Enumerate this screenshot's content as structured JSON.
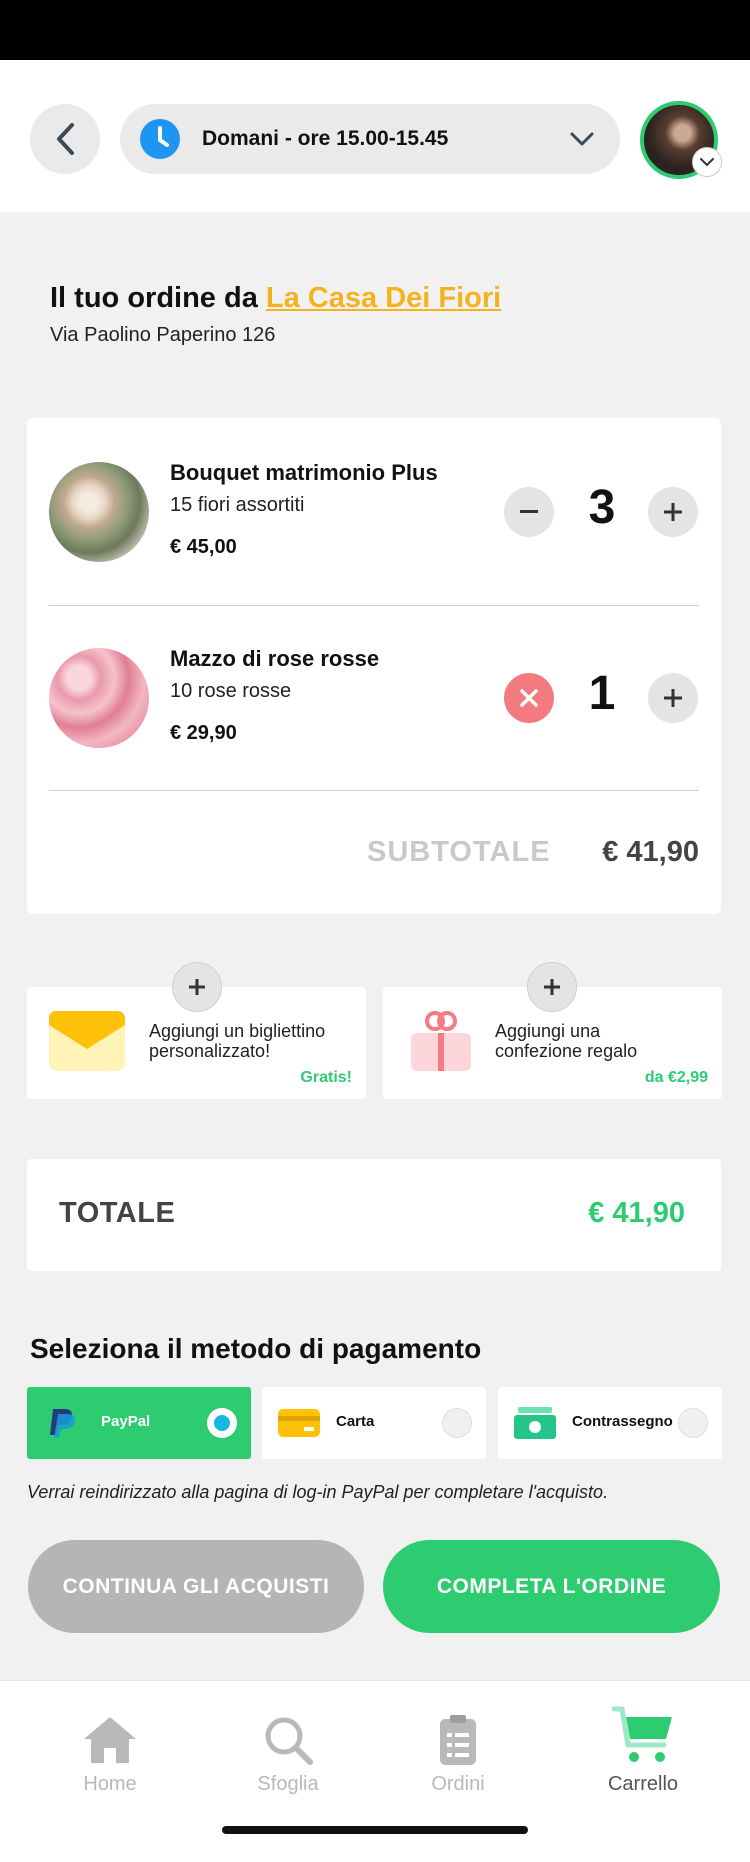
{
  "header": {
    "delivery_slot": "Domani - ore 15.00-15.45"
  },
  "order": {
    "title_prefix": "Il tuo ordine da",
    "shop_name": "La Casa Dei Fiori",
    "address": "Via Paolino Paperino 126"
  },
  "cart": {
    "items": [
      {
        "name": "Bouquet matrimonio Plus",
        "description": "15 fiori assortiti",
        "price": "€ 45,00",
        "quantity": "3"
      },
      {
        "name": "Mazzo di rose rosse",
        "description": "10 rose rosse",
        "price": "€ 29,90",
        "quantity": "1"
      }
    ],
    "subtotal_label": "SUBTOTALE",
    "subtotal_value": "€ 41,90"
  },
  "addons": [
    {
      "line1": "Aggiungi un bigliettino",
      "line2": "personalizzato!",
      "price": "Gratis!"
    },
    {
      "line1": "Aggiungi una",
      "line2": "confezione regalo",
      "price": "da €2,99"
    }
  ],
  "total": {
    "label": "TOTALE",
    "value": "€ 41,90"
  },
  "payment": {
    "title": "Seleziona il metodo di pagamento",
    "options": [
      {
        "label": "PayPal",
        "selected": true
      },
      {
        "label": "Carta",
        "selected": false
      },
      {
        "label": "Contrassegno",
        "selected": false
      }
    ],
    "note": "Verrai reindirizzato alla pagina di log-in PayPal per completare l'acquisto."
  },
  "actions": {
    "continue_label": "CONTINUA GLI ACQUISTI",
    "complete_label": "COMPLETA L'ORDINE"
  },
  "tabbar": {
    "items": [
      {
        "label": "Home",
        "icon": "home-icon"
      },
      {
        "label": "Sfoglia",
        "icon": "search-icon"
      },
      {
        "label": "Ordini",
        "icon": "clipboard-icon"
      },
      {
        "label": "Carrello",
        "icon": "cart-icon",
        "active": true
      }
    ]
  },
  "colors": {
    "accent_green": "#2ecc71",
    "shop_link": "#f5b21e",
    "clock_blue": "#1e95f0",
    "remove_red": "#f37b80"
  }
}
